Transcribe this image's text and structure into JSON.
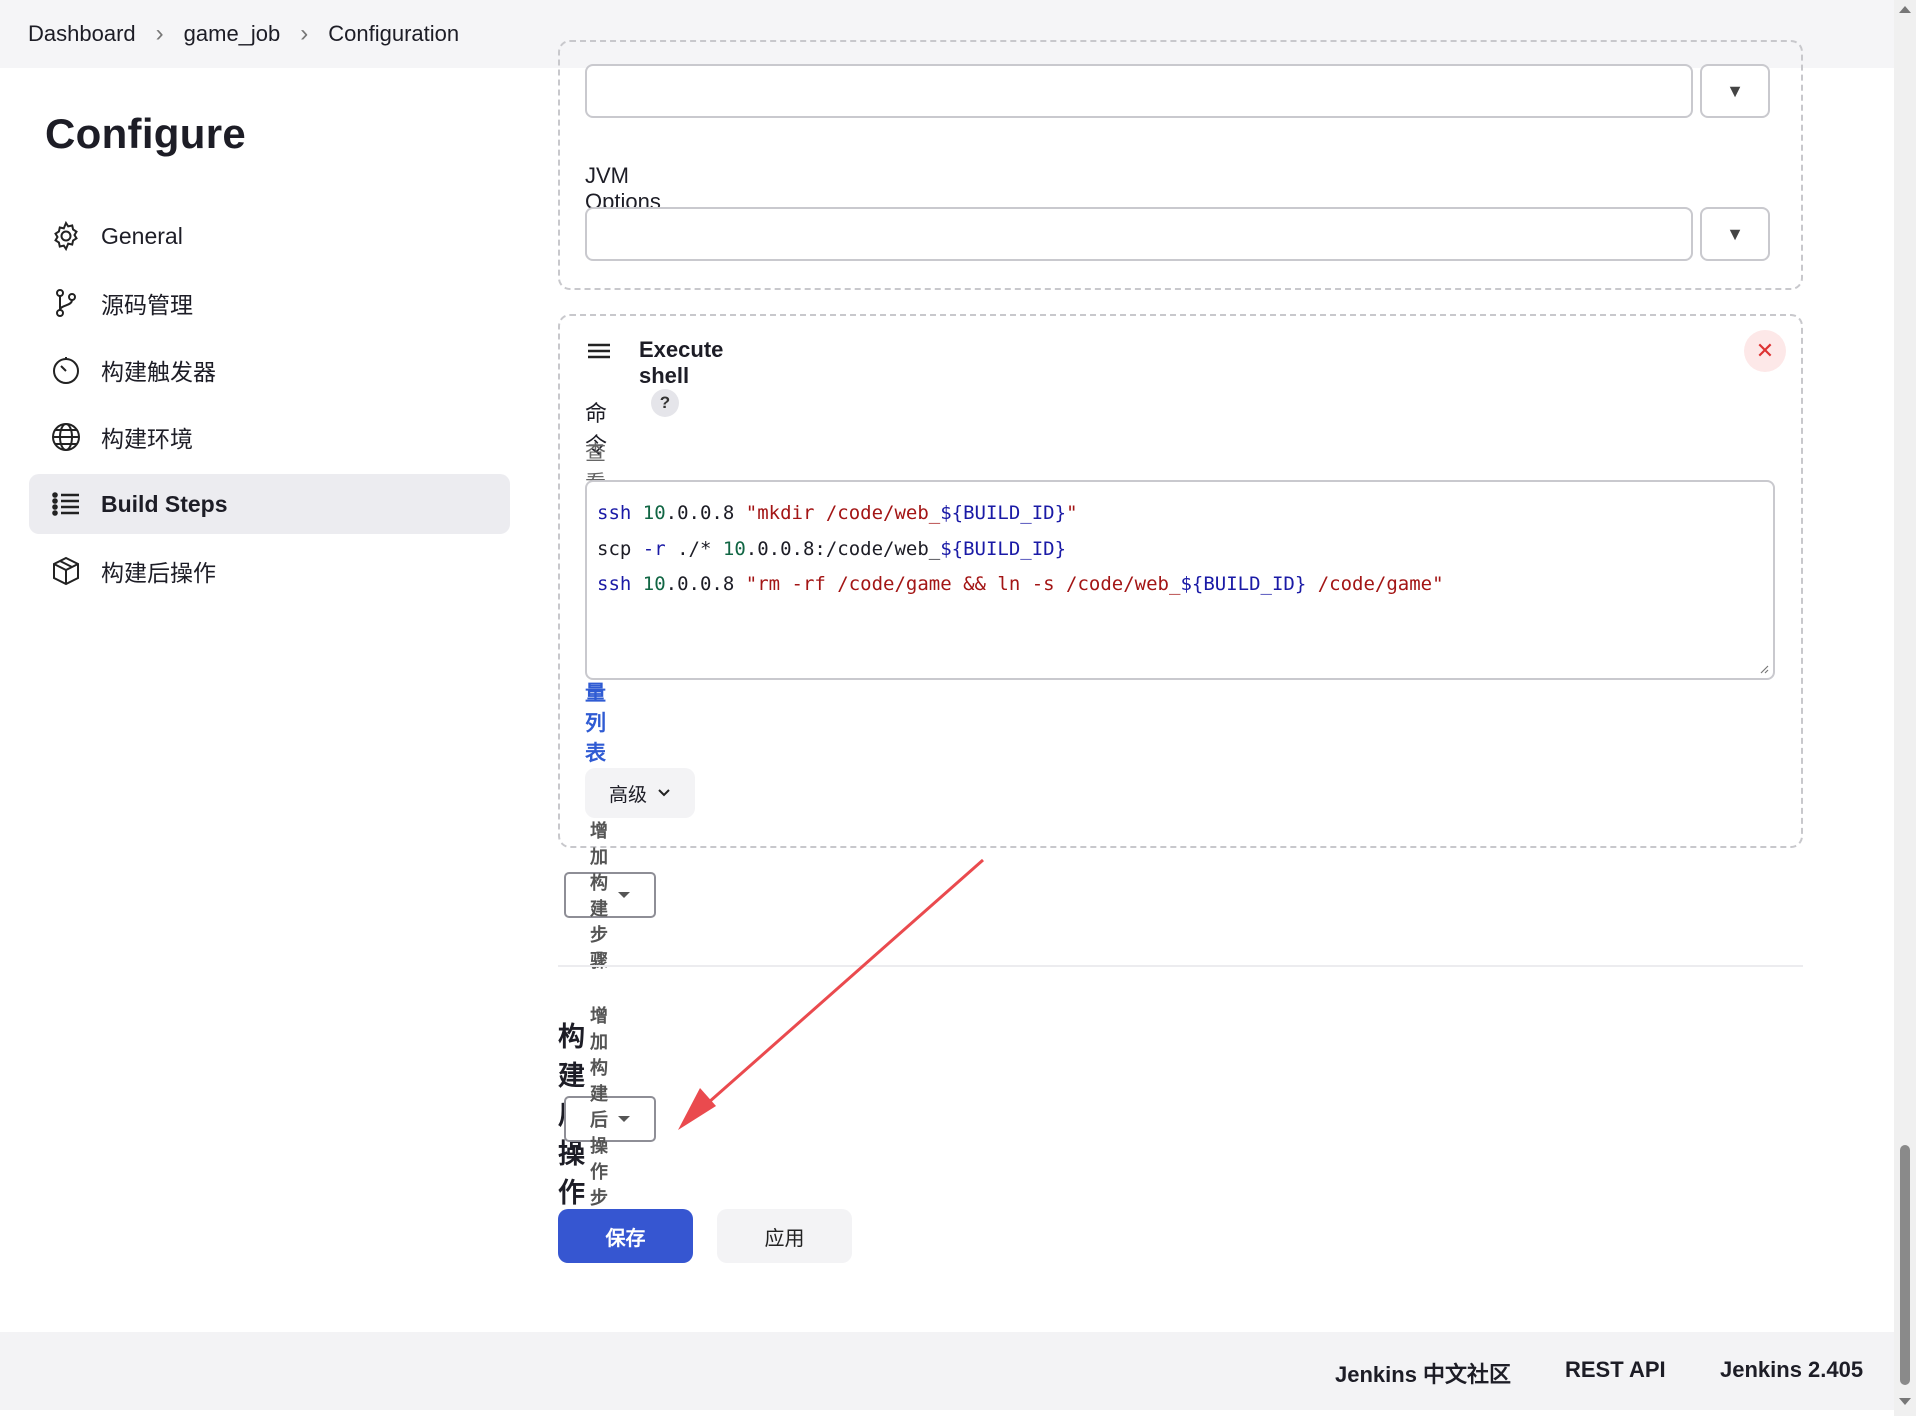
{
  "breadcrumb": {
    "items": [
      "Dashboard",
      "game_job",
      "Configuration"
    ]
  },
  "sidebar": {
    "title": "Configure",
    "items": [
      {
        "label": "General",
        "icon": "gear-icon"
      },
      {
        "label": "源码管理",
        "icon": "branch-icon"
      },
      {
        "label": "构建触发器",
        "icon": "timer-icon"
      },
      {
        "label": "构建环境",
        "icon": "globe-icon"
      },
      {
        "label": "Build Steps",
        "icon": "list-icon",
        "active": true
      },
      {
        "label": "构建后操作",
        "icon": "package-icon"
      }
    ]
  },
  "ant_section": {
    "jvm_label": "JVM Options",
    "help": "?"
  },
  "shell_step": {
    "title": "Execute shell",
    "help": "?",
    "command_label": "命令",
    "env_prefix": "查看",
    "env_link": "可用的环境变量列表",
    "advanced_label": "高级",
    "code_lines": [
      "ssh 10.0.0.8 \"mkdir /code/web_${BUILD_ID}\"",
      "scp -r ./* 10.0.0.8:/code/web_${BUILD_ID}",
      "ssh 10.0.0.8 \"rm -rf /code/game && ln -s /code/web_${BUILD_ID} /code/game\""
    ]
  },
  "add_build_step_label": "增加构建步骤",
  "post_build": {
    "title": "构建后操作",
    "add_label": "增加构建后操作步骤"
  },
  "actions": {
    "save_label": "保存",
    "apply_label": "应用"
  },
  "footer": {
    "community": "Jenkins 中文社区",
    "rest_api": "REST API",
    "version": "Jenkins 2.405"
  },
  "colors": {
    "primary": "#3656d1",
    "link": "#2f5bd3",
    "annotation_arrow": "#ea4a4e"
  }
}
